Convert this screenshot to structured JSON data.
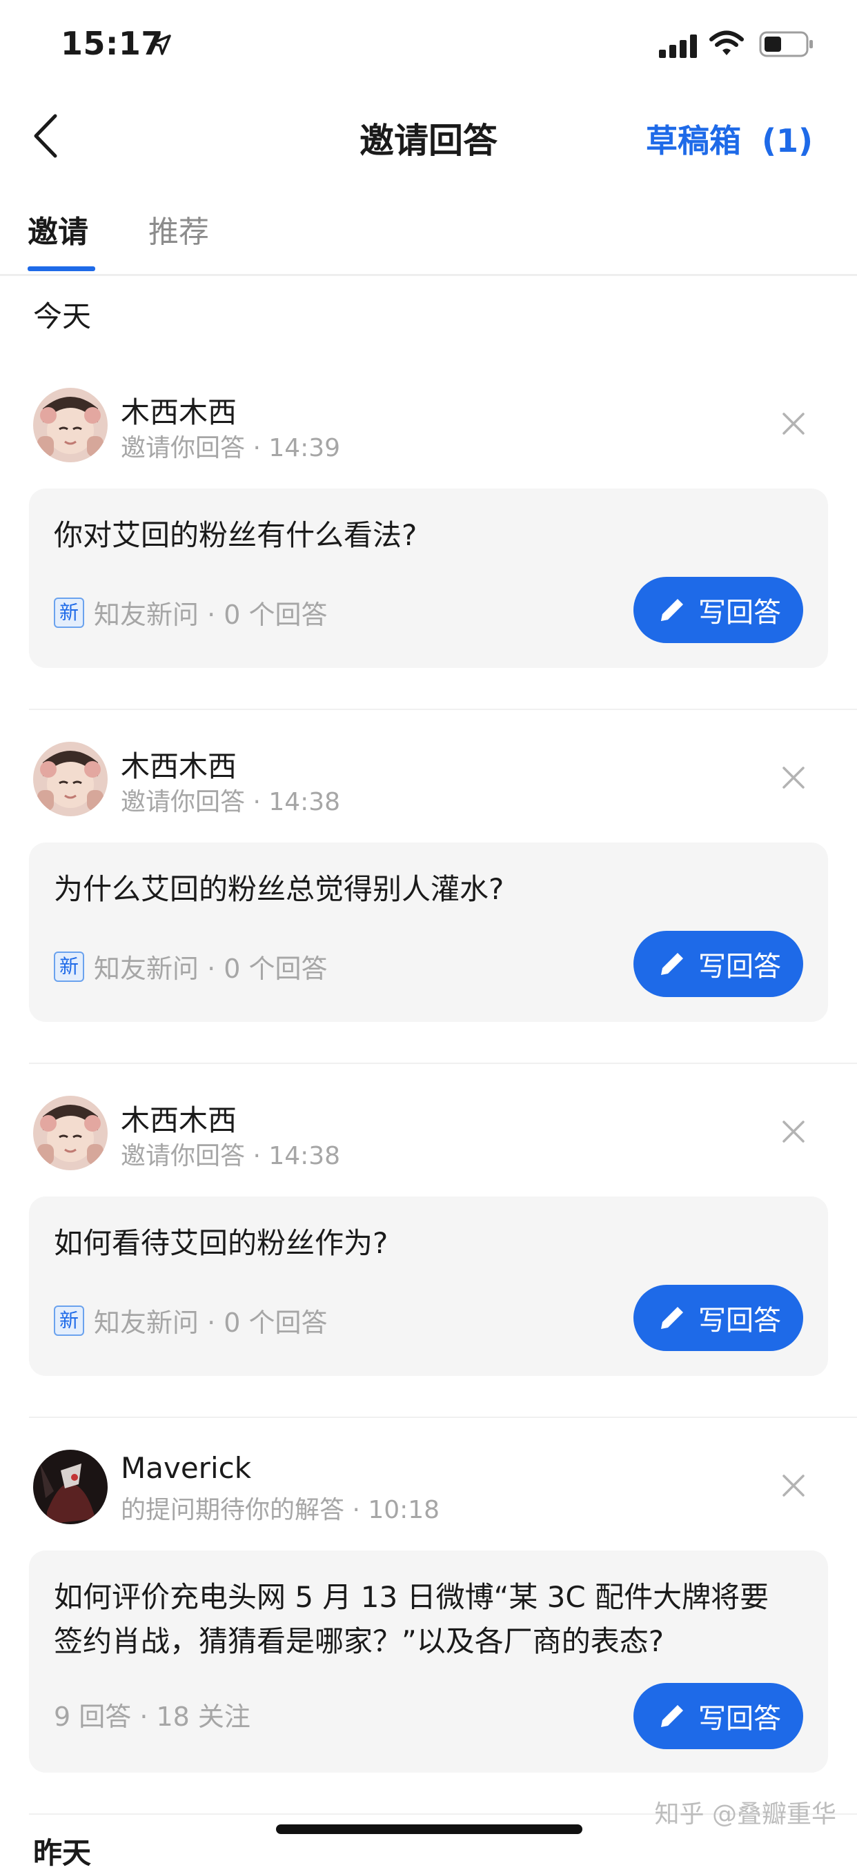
{
  "status_bar": {
    "time": "15:17"
  },
  "nav": {
    "title": "邀请回答",
    "drafts_label": "草稿箱",
    "drafts_count": "(1)"
  },
  "tabs": [
    {
      "label": "邀请"
    },
    {
      "label": "推荐"
    }
  ],
  "sections": {
    "today": "今天",
    "yesterday": "昨天"
  },
  "items": [
    {
      "inviter": "木西木西",
      "meta": "邀请你回答 · 14:39",
      "question": "你对艾回的粉丝有什么看法?",
      "badge": "新",
      "stats": "知友新问 · 0 个回答",
      "button": "写回答"
    },
    {
      "inviter": "木西木西",
      "meta": "邀请你回答 · 14:38",
      "question": "为什么艾回的粉丝总觉得别人灌水?",
      "badge": "新",
      "stats": "知友新问 · 0 个回答",
      "button": "写回答"
    },
    {
      "inviter": "木西木西",
      "meta": "邀请你回答 · 14:38",
      "question": "如何看待艾回的粉丝作为?",
      "badge": "新",
      "stats": "知友新问 · 0 个回答",
      "button": "写回答"
    },
    {
      "inviter": "Maverick",
      "meta": "的提问期待你的解答 · 10:18",
      "question": "如何评价充电头网 5 月 13 日微博“某 3C 配件大牌将要签约肖战，猜猜看是哪家？”以及各厂商的表态?",
      "stats": "9 回答 · 18 关注",
      "button": "写回答"
    }
  ],
  "watermark": "知乎 @叠瓣重华",
  "colors": {
    "accent": "#1e6ae8",
    "card_bg": "#f5f5f5",
    "muted_text": "#a6a6a6"
  }
}
